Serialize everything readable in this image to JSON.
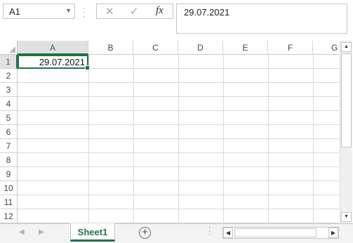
{
  "namebox": {
    "value": "A1",
    "dropdown_icon": "chevron-down-icon"
  },
  "formula_buttons": {
    "cancel": "✕",
    "enter": "✓",
    "fx": "fx"
  },
  "formula_bar": {
    "value": "29.07.2021"
  },
  "columns": [
    "A",
    "B",
    "C",
    "D",
    "E",
    "F",
    "G"
  ],
  "rows": [
    "1",
    "2",
    "3",
    "4",
    "5",
    "6",
    "7",
    "8",
    "9",
    "10",
    "11",
    "12"
  ],
  "cells": {
    "A1": "29.07.2021"
  },
  "active_cell": "A1",
  "sheet_tabs": [
    {
      "label": "Sheet1",
      "active": true
    }
  ],
  "colors": {
    "accent": "#217346",
    "gridline": "#dadada"
  }
}
